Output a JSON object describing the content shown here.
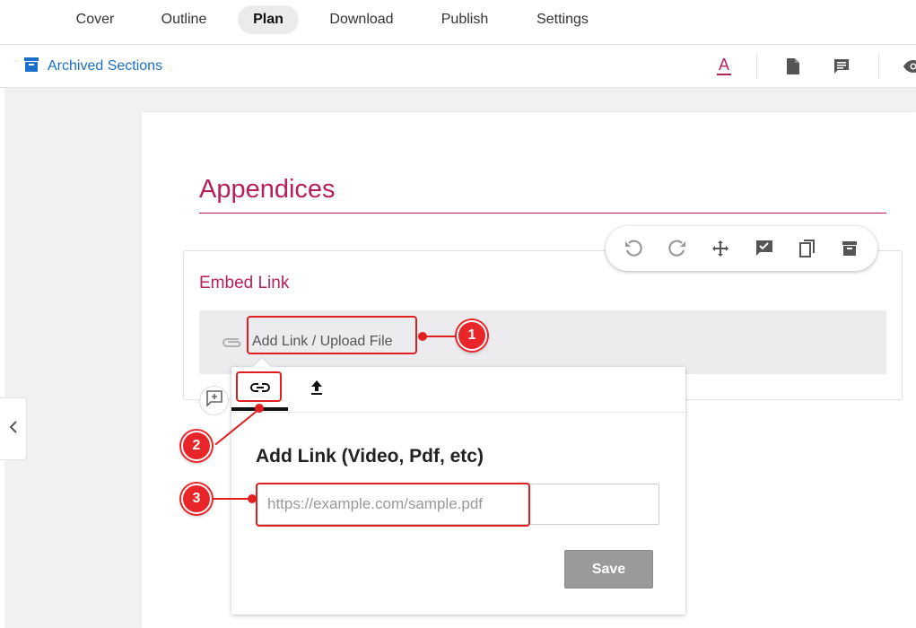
{
  "nav": {
    "tabs": [
      {
        "label": "Cover"
      },
      {
        "label": "Outline"
      },
      {
        "label": "Plan"
      },
      {
        "label": "Download"
      },
      {
        "label": "Publish"
      },
      {
        "label": "Settings"
      }
    ],
    "active_tab": "Plan"
  },
  "toolbar": {
    "archived_label": "Archived Sections",
    "icons": [
      "archive-icon",
      "text-color-icon",
      "document-icon",
      "comment-icon",
      "eye-icon"
    ]
  },
  "section": {
    "heading": "Appendices",
    "card_title": "Embed Link",
    "attach_label": "Add Link / Upload File",
    "floating_toolbar_icons": [
      "undo-icon",
      "redo-icon",
      "move-icon",
      "approve-icon",
      "copy-icon",
      "archive-icon"
    ]
  },
  "popover": {
    "tabs": [
      "link-icon",
      "upload-icon"
    ],
    "active_tab": "link-icon",
    "title": "Add Link (Video, Pdf, etc)",
    "input_value": "",
    "input_placeholder": "https://example.com/sample.pdf",
    "save_label": "Save"
  },
  "annotations": [
    "1",
    "2",
    "3"
  ],
  "colors": {
    "accent": "#b7205d",
    "link_blue": "#1a6fc9",
    "annotation_red": "#e02020",
    "save_disabled": "#9a9a9a"
  }
}
